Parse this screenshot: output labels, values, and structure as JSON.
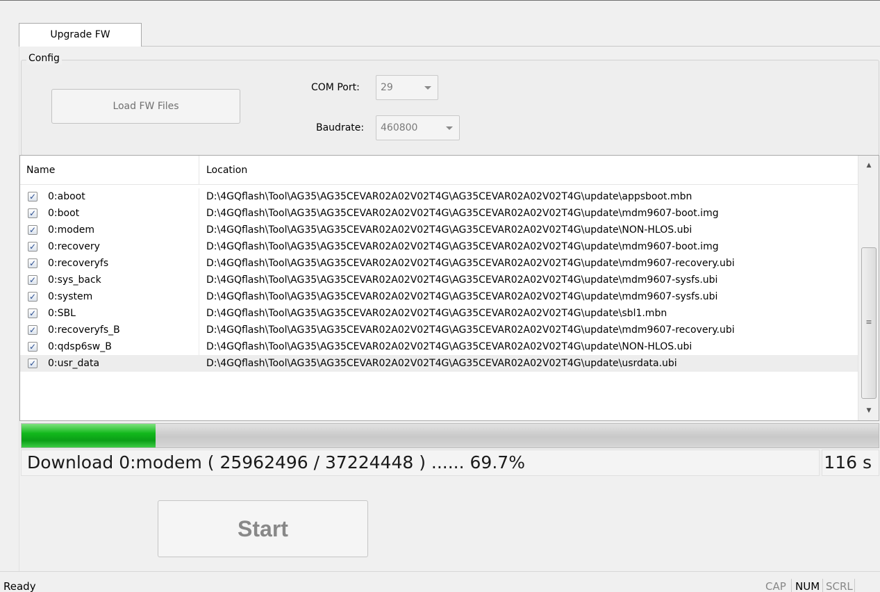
{
  "tabs": [
    {
      "label": "Upgrade FW",
      "active": true
    }
  ],
  "config": {
    "legend": "Config",
    "load_button": "Load FW Files",
    "com_port": {
      "label": "COM Port:",
      "value": "29"
    },
    "baudrate": {
      "label": "Baudrate:",
      "value": "460800"
    }
  },
  "file_list": {
    "columns": [
      "Name",
      "Location"
    ],
    "rows": [
      {
        "checked": true,
        "name": "0:aboot",
        "location": "D:\\4GQflash\\Tool\\AG35\\AG35CEVAR02A02V02T4G\\AG35CEVAR02A02V02T4G\\update\\appsboot.mbn"
      },
      {
        "checked": true,
        "name": "0:boot",
        "location": "D:\\4GQflash\\Tool\\AG35\\AG35CEVAR02A02V02T4G\\AG35CEVAR02A02V02T4G\\update\\mdm9607-boot.img"
      },
      {
        "checked": true,
        "name": "0:modem",
        "location": "D:\\4GQflash\\Tool\\AG35\\AG35CEVAR02A02V02T4G\\AG35CEVAR02A02V02T4G\\update\\NON-HLOS.ubi"
      },
      {
        "checked": true,
        "name": "0:recovery",
        "location": "D:\\4GQflash\\Tool\\AG35\\AG35CEVAR02A02V02T4G\\AG35CEVAR02A02V02T4G\\update\\mdm9607-boot.img"
      },
      {
        "checked": true,
        "name": "0:recoveryfs",
        "location": "D:\\4GQflash\\Tool\\AG35\\AG35CEVAR02A02V02T4G\\AG35CEVAR02A02V02T4G\\update\\mdm9607-recovery.ubi"
      },
      {
        "checked": true,
        "name": "0:sys_back",
        "location": "D:\\4GQflash\\Tool\\AG35\\AG35CEVAR02A02V02T4G\\AG35CEVAR02A02V02T4G\\update\\mdm9607-sysfs.ubi"
      },
      {
        "checked": true,
        "name": "0:system",
        "location": "D:\\4GQflash\\Tool\\AG35\\AG35CEVAR02A02V02T4G\\AG35CEVAR02A02V02T4G\\update\\mdm9607-sysfs.ubi"
      },
      {
        "checked": true,
        "name": "0:SBL",
        "location": "D:\\4GQflash\\Tool\\AG35\\AG35CEVAR02A02V02T4G\\AG35CEVAR02A02V02T4G\\update\\sbl1.mbn"
      },
      {
        "checked": true,
        "name": "0:recoveryfs_B",
        "location": "D:\\4GQflash\\Tool\\AG35\\AG35CEVAR02A02V02T4G\\AG35CEVAR02A02V02T4G\\update\\mdm9607-recovery.ubi"
      },
      {
        "checked": true,
        "name": "0:qdsp6sw_B",
        "location": "D:\\4GQflash\\Tool\\AG35\\AG35CEVAR02A02V02T4G\\AG35CEVAR02A02V02T4G\\update\\NON-HLOS.ubi"
      },
      {
        "checked": true,
        "name": "0:usr_data",
        "location": "D:\\4GQflash\\Tool\\AG35\\AG35CEVAR02A02V02T4G\\AG35CEVAR02A02V02T4G\\update\\usrdata.ubi",
        "selected": true
      }
    ]
  },
  "progress": {
    "fraction": 0.156
  },
  "download_status": {
    "text": "Download 0:modem ( 25962496 / 37224448 ) ...... 69.7%",
    "elapsed": "116 s"
  },
  "start_button": "Start",
  "status_bar": {
    "text": "Ready",
    "indicators": [
      "CAP",
      "NUM",
      "SCRL"
    ]
  },
  "icons": {
    "check": "checkmark-icon",
    "scroll_up": "scroll-up-arrow-icon",
    "scroll_down": "scroll-down-arrow-icon",
    "grip": "scroll-grip-icon",
    "combo": "dropdown-arrow-icon"
  },
  "colors": {
    "progress_fill": "#12b81c",
    "window_bg": "#f0f0f0"
  }
}
